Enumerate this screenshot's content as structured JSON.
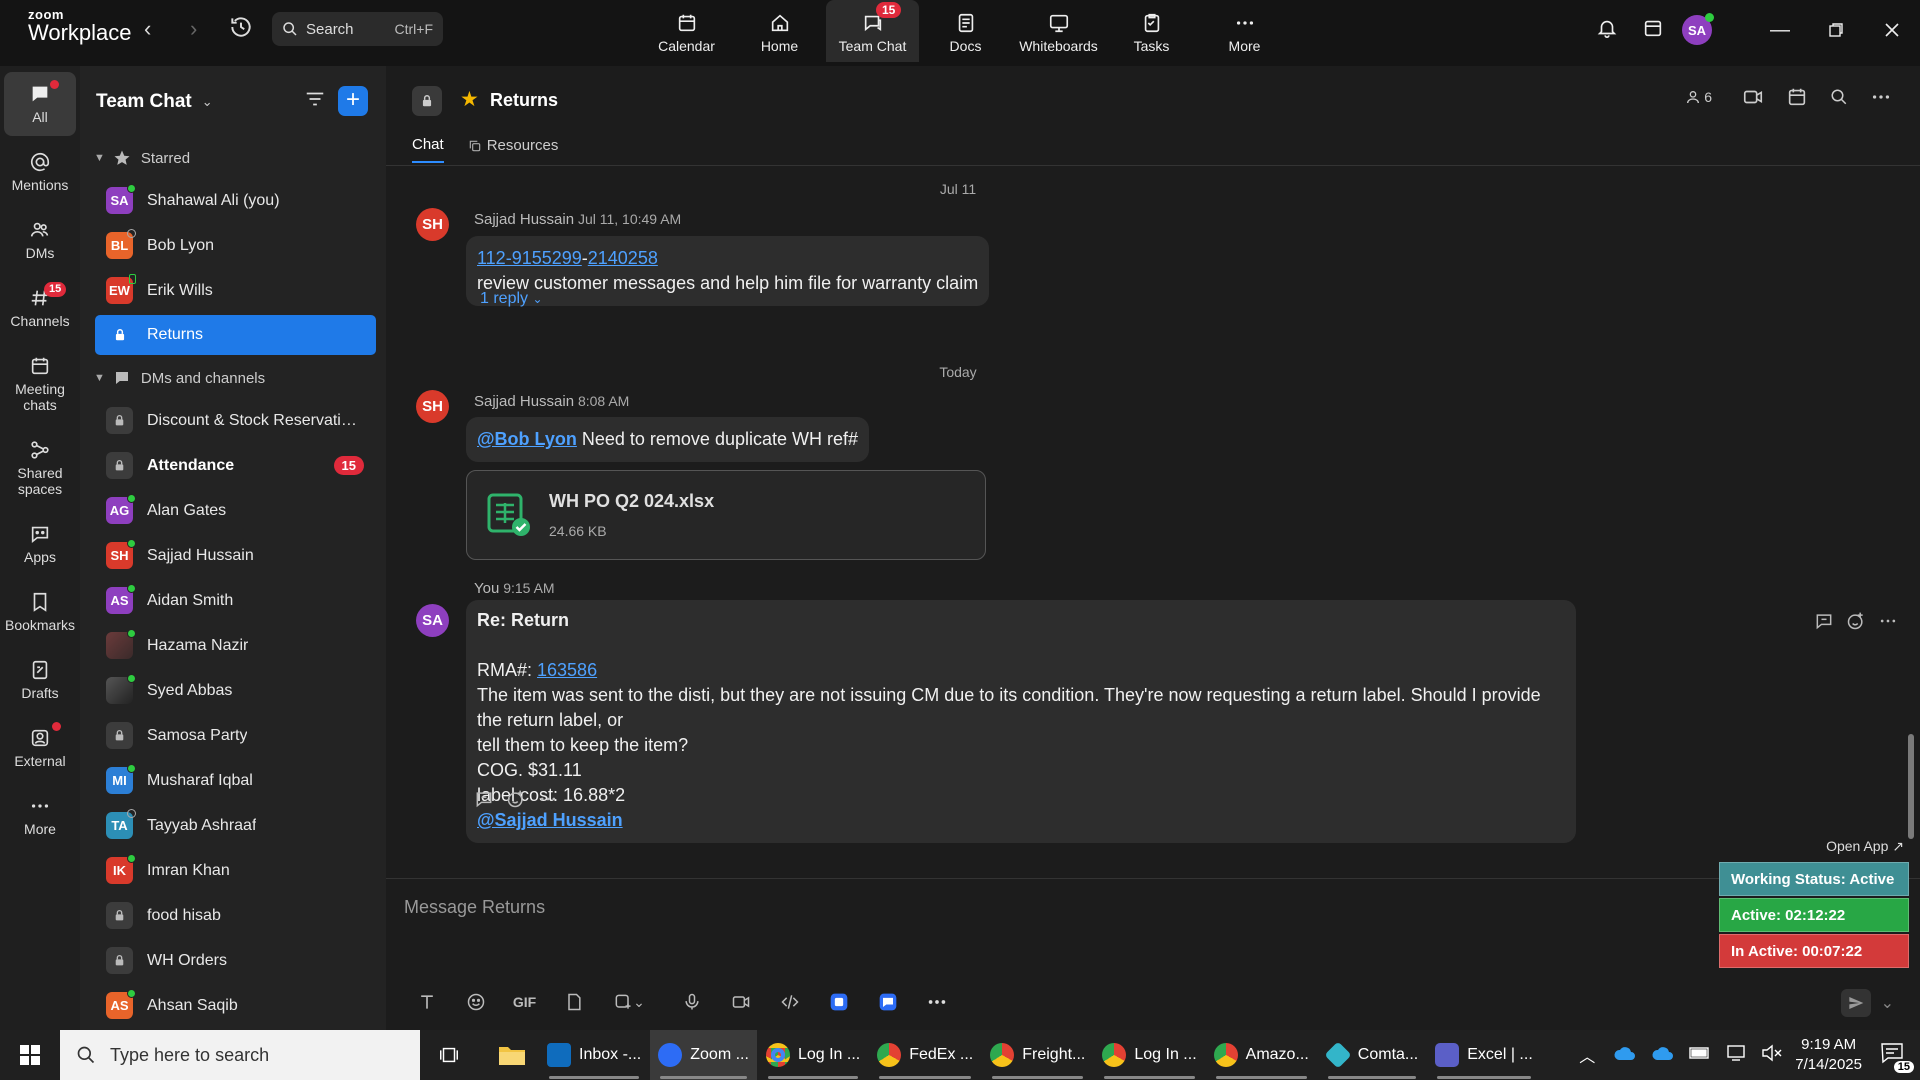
{
  "app": {
    "brand_top": "zoom",
    "brand_bottom": "Workplace"
  },
  "search": {
    "label": "Search",
    "shortcut": "Ctrl+F"
  },
  "topnav": [
    {
      "label": "Calendar"
    },
    {
      "label": "Home"
    },
    {
      "label": "Team Chat",
      "badge": "15"
    },
    {
      "label": "Docs"
    },
    {
      "label": "Whiteboards"
    },
    {
      "label": "Tasks"
    },
    {
      "label": "More"
    }
  ],
  "user": {
    "initials": "SA",
    "color": "#8e3fbf"
  },
  "rail": [
    {
      "label": "All"
    },
    {
      "label": "Mentions"
    },
    {
      "label": "DMs"
    },
    {
      "label": "Channels",
      "badge": "15"
    },
    {
      "label": "Meeting chats"
    },
    {
      "label": "Shared spaces"
    },
    {
      "label": "Apps"
    },
    {
      "label": "Bookmarks"
    },
    {
      "label": "Drafts"
    },
    {
      "label": "External"
    },
    {
      "label": "More"
    }
  ],
  "sidebar": {
    "title": "Team Chat",
    "starred_label": "Starred",
    "starred": [
      {
        "initials": "SA",
        "name": "Shahawal Ali (you)",
        "color": "#8e3fbf"
      },
      {
        "initials": "BL",
        "name": "Bob Lyon",
        "color": "#e8642a"
      },
      {
        "initials": "EW",
        "name": "Erik Wills",
        "color": "#d93a2b"
      },
      {
        "name": "Returns"
      }
    ],
    "dms_label": "DMs and channels",
    "dms": [
      {
        "type": "lock",
        "name": "Discount & Stock Reservatio..."
      },
      {
        "type": "lock",
        "name": "Attendance",
        "count": "15"
      },
      {
        "initials": "AG",
        "name": "Alan Gates",
        "color": "#8e3fbf"
      },
      {
        "initials": "SH",
        "name": "Sajjad Hussain",
        "color": "#d93a2b"
      },
      {
        "initials": "AS",
        "name": "Aidan Smith",
        "color": "#8e3fbf"
      },
      {
        "initials": "",
        "name": "Hazama Nazir",
        "color": "#5a3a3a"
      },
      {
        "initials": "",
        "name": "Syed Abbas",
        "color": "#3a3a3a"
      },
      {
        "type": "lock",
        "name": "Samosa Party"
      },
      {
        "initials": "MI",
        "name": "Musharaf Iqbal",
        "color": "#2c7fd6"
      },
      {
        "initials": "TA",
        "name": "Tayyab Ashraaf",
        "color": "#2c8fb6"
      },
      {
        "initials": "IK",
        "name": "Imran Khan",
        "color": "#d93a2b"
      },
      {
        "type": "lock",
        "name": "food hisab"
      },
      {
        "type": "lock",
        "name": "WH Orders"
      },
      {
        "initials": "AS",
        "name": "Ahsan Saqib",
        "color": "#e8642a"
      }
    ]
  },
  "channel": {
    "name": "Returns",
    "tabs": [
      {
        "label": "Chat"
      },
      {
        "label": "Resources"
      }
    ],
    "members": "6"
  },
  "messages": {
    "day1": "Jul 11",
    "m1": {
      "initials": "SH",
      "author": "Sajjad Hussain",
      "time": "Jul 11, 10:49 AM",
      "link1": "112-9155299",
      "sep": "-",
      "link2": "2140258",
      "text": "review customer messages and help him file for warranty claim",
      "reply": "1 reply"
    },
    "day2": "Today",
    "m2": {
      "initials": "SH",
      "author": "Sajjad Hussain",
      "time": "8:08 AM",
      "mention": "@Bob Lyon",
      "text": " Need to remove duplicate WH ref#",
      "file_name": "WH PO Q2 024.xlsx",
      "file_size": "24.66 KB"
    },
    "m3": {
      "initials": "SA",
      "author": "You",
      "time": "9:15 AM",
      "title": "Re: Return",
      "rma_label": "RMA#: ",
      "rma": "163586",
      "line1": "The item was sent to the disti, but they are not issuing CM due to its condition. They're now requesting a return label. Should I provide the return label, or",
      "line2": "tell them to keep the item?",
      "line3": "COG. $31.11",
      "line4": "label cost: 16.88*2",
      "mention": "@Sajjad Hussain"
    }
  },
  "composer": {
    "placeholder": "Message Returns",
    "gif": "GIF"
  },
  "widget": {
    "open_app": "Open App ↗",
    "status": "Working Status: Active",
    "active": "Active: 02:12:22",
    "inactive": "In Active: 00:07:22"
  },
  "taskbar": {
    "search_placeholder": "Type here to search",
    "apps": [
      {
        "label": "Inbox -...",
        "color": "#0f6cbd"
      },
      {
        "label": "Zoom ...",
        "color": "#2d6cf5"
      },
      {
        "label": "Log In ...",
        "color": "#e34133"
      },
      {
        "label": "FedEx ...",
        "color": "#e34133"
      },
      {
        "label": "Freight...",
        "color": "#e34133"
      },
      {
        "label": "Log In ...",
        "color": "#e34133"
      },
      {
        "label": "Amazo...",
        "color": "#e34133"
      },
      {
        "label": "Comta...",
        "color": "#33b5c9"
      },
      {
        "label": "Excel | ...",
        "color": "#5b5fc7"
      }
    ],
    "time": "9:19 AM",
    "date": "7/14/2025",
    "notif": "15"
  }
}
